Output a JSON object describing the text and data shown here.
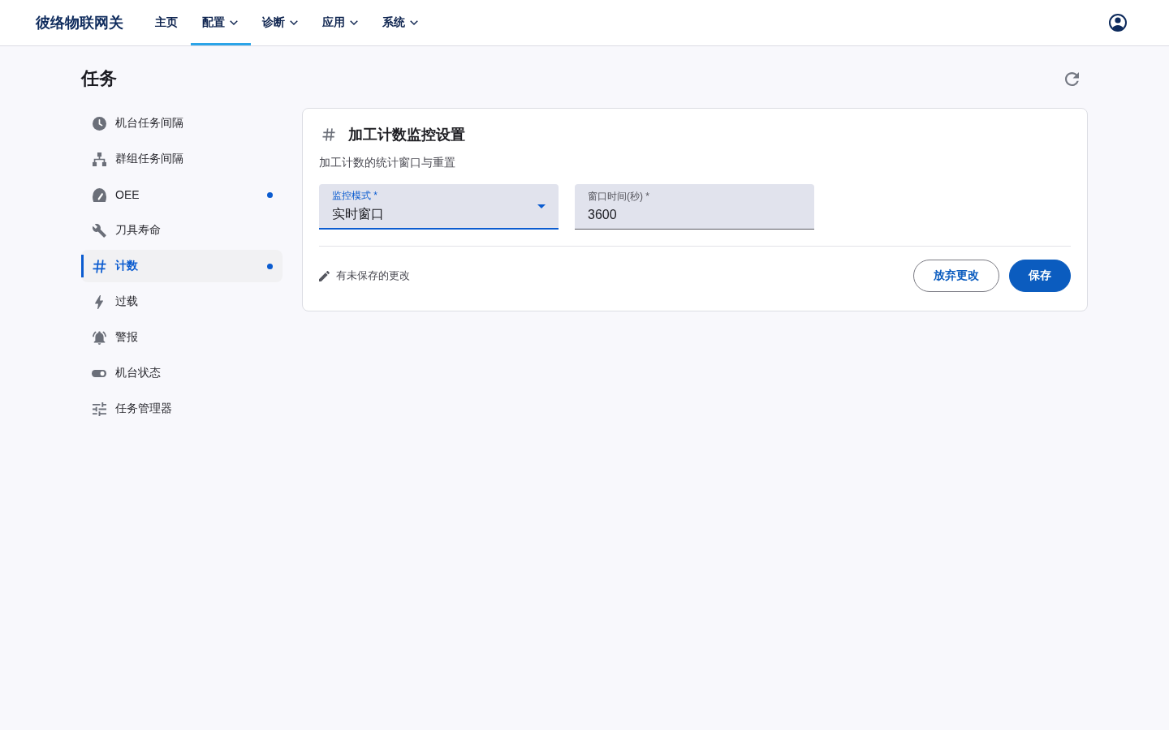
{
  "app": {
    "brand": "彼络物联网关"
  },
  "nav": [
    {
      "label": "主页",
      "selected": false,
      "has_menu": false
    },
    {
      "label": "配置",
      "selected": true,
      "has_menu": true
    },
    {
      "label": "诊断",
      "selected": false,
      "has_menu": true
    },
    {
      "label": "应用",
      "selected": false,
      "has_menu": true
    },
    {
      "label": "系统",
      "selected": false,
      "has_menu": true
    }
  ],
  "page": {
    "title": "任务"
  },
  "sidebar": {
    "items": [
      {
        "label": "机台任务间隔",
        "selected": false,
        "unsaved": false
      },
      {
        "label": "群组任务间隔",
        "selected": false,
        "unsaved": false
      },
      {
        "label": "OEE",
        "selected": false,
        "unsaved": true
      },
      {
        "label": "刀具寿命",
        "selected": false,
        "unsaved": false
      },
      {
        "label": "计数",
        "selected": true,
        "unsaved": true
      },
      {
        "label": "过载",
        "selected": false,
        "unsaved": false
      },
      {
        "label": "警报",
        "selected": false,
        "unsaved": false
      },
      {
        "label": "机台状态",
        "selected": false,
        "unsaved": false
      },
      {
        "label": "任务管理器",
        "selected": false,
        "unsaved": false
      }
    ]
  },
  "card": {
    "title": "加工计数监控设置",
    "subtitle": "加工计数的统计窗口与重置",
    "fields": [
      {
        "kind": "select",
        "label": "监控模式 *",
        "value": "实时窗口",
        "focused": true
      },
      {
        "kind": "text",
        "label": "窗口时间(秒) *",
        "value": "3600",
        "focused": false
      }
    ],
    "status": "有未保存的更改",
    "buttons": [
      {
        "kind": "outlined",
        "label": "放弃更改"
      },
      {
        "kind": "contained",
        "label": "保存"
      }
    ]
  }
}
